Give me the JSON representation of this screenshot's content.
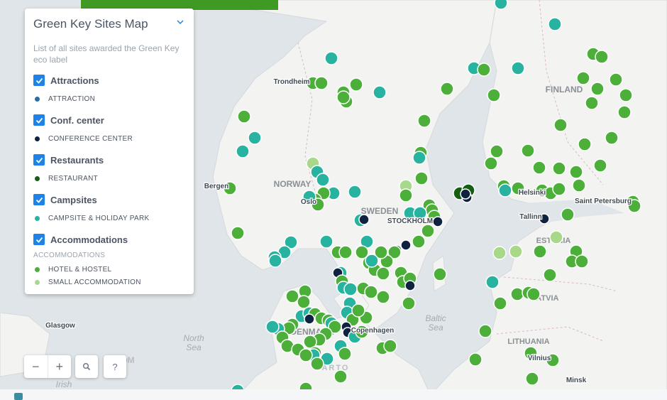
{
  "panel": {
    "title": "Green Key Sites Map",
    "description": "List of all sites awarded the Green Key eco label",
    "layers": [
      {
        "label": "Attractions",
        "legend": [
          {
            "label": "ATTRACTION",
            "color": "#2a6ea6"
          }
        ]
      },
      {
        "label": "Conf. center",
        "legend": [
          {
            "label": "CONFERENCE CENTER",
            "color": "#0f2340"
          }
        ]
      },
      {
        "label": "Restaurants",
        "legend": [
          {
            "label": "RESTAURANT",
            "color": "#155e12"
          }
        ]
      },
      {
        "label": "Campsites",
        "legend": [
          {
            "label": "CAMPSITE & HOLIDAY PARK",
            "color": "#27b3a0"
          }
        ]
      },
      {
        "label": "Accommodations",
        "group": "ACCOMMODATIONS",
        "legend": [
          {
            "label": "HOTEL & HOSTEL",
            "color": "#4caf3a"
          },
          {
            "label": "SMALL ACCOMMODATION",
            "color": "#a8d98a"
          }
        ]
      }
    ]
  },
  "controls": {
    "zoom_out": "−",
    "zoom_in": "+",
    "search_icon": "search-icon",
    "help": "?"
  },
  "map": {
    "countries": [
      "NORWAY",
      "SWEDEN",
      "FINLAND",
      "ESTONIA",
      "LATVIA",
      "LITHUANIA",
      "DENMARK"
    ],
    "cities": [
      "Trondheim",
      "Bergen",
      "Oslo",
      "STOCKHOLM",
      "Helsinki",
      "Tallinn",
      "Saint Petersburg",
      "Vilnius",
      "Minsk",
      "Copenhagen",
      "Glasgow"
    ],
    "seas": [
      "North",
      "Sea",
      "Baltic",
      "Sea"
    ],
    "fragments": [
      "CARTO",
      "Irish",
      "OM"
    ]
  }
}
